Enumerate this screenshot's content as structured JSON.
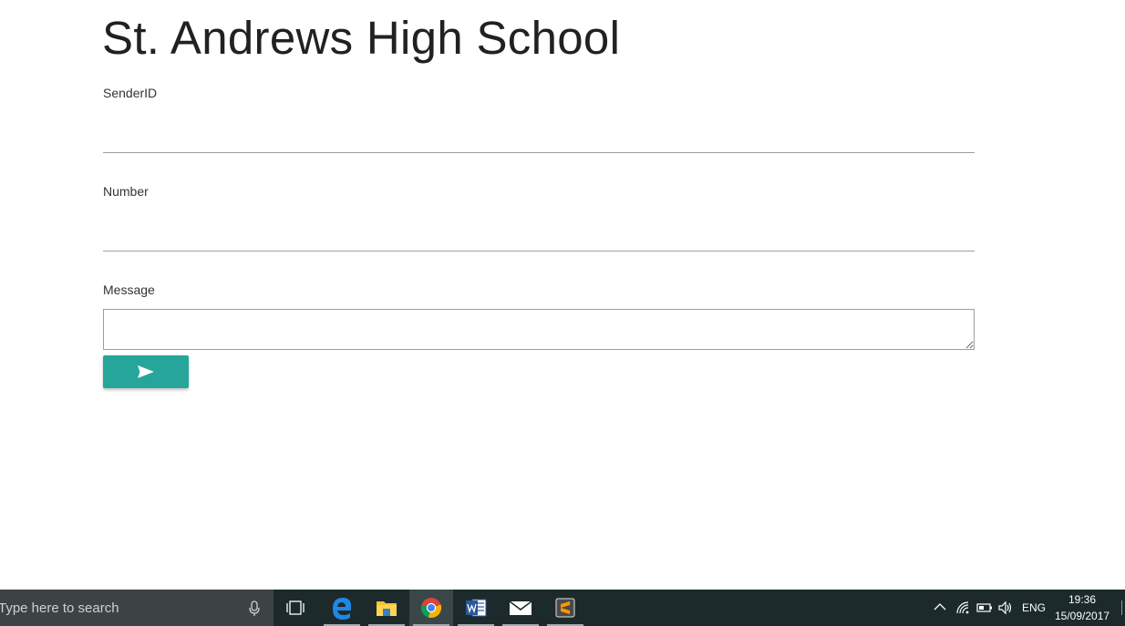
{
  "page": {
    "title": "St. Andrews High School"
  },
  "form": {
    "sender_label": "SenderID",
    "sender_value": "",
    "number_label": "Number",
    "number_value": "",
    "message_label": "Message",
    "message_value": "",
    "send_icon": "send-icon"
  },
  "taskbar": {
    "search_placeholder": "Type here to search",
    "apps": [
      "task-view",
      "edge",
      "file-explorer",
      "chrome",
      "word",
      "mail",
      "sublime-text"
    ],
    "tray": {
      "language": "ENG",
      "time": "19:36",
      "date": "15/09/2017"
    }
  },
  "colors": {
    "accent": "#26a69a",
    "taskbar": "#1c2a2c"
  }
}
